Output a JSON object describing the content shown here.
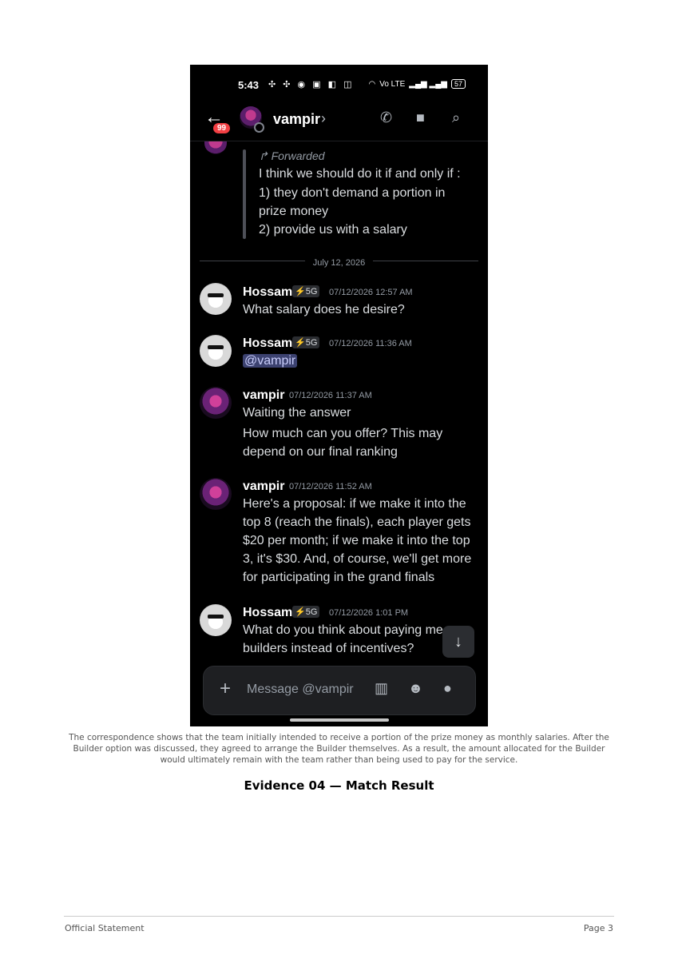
{
  "status_bar": {
    "time": "5:43",
    "notification_icons": "✣ ✣ ◉ ▣ ◧ ◫",
    "network": "Vo LTE",
    "signal": "▂▄▆ ▂▄▆",
    "battery": "57"
  },
  "header": {
    "unread_badge": "99",
    "name": "vampir",
    "chevron": "›"
  },
  "forwarded": {
    "label": "Forwarded",
    "lines": [
      "I think we should do it if and only if :",
      "1) they don't demand a portion in",
      "prize money",
      "2) provide us with a salary"
    ]
  },
  "date_divider": "July 12, 2026",
  "messages": [
    {
      "author": "Hossam",
      "tag": "5G",
      "timestamp": "07/12/2026 12:57 AM",
      "text": "What salary does he desire?"
    },
    {
      "author": "Hossam",
      "tag": "5G",
      "timestamp": "07/12/2026 11:36 AM",
      "mention": "@vampir"
    },
    {
      "author": "vampir",
      "timestamp": "07/12/2026 11:37 AM",
      "lines": [
        "Waiting the answer",
        "How much can you offer? This may",
        "depend on our final ranking"
      ]
    },
    {
      "author": "vampir",
      "timestamp": "07/12/2026 11:52 AM",
      "lines": [
        "Here's a proposal: if we make it into the",
        "top 8 (reach the finals), each player gets",
        "$20 per month; if we make it into the top",
        "3, it's $30. And, of course, we'll get more",
        "for participating in the grand finals"
      ]
    },
    {
      "author": "Hossam",
      "tag": "5G",
      "timestamp": "07/12/2026 1:01 PM",
      "lines": [
        "What do you think about paying me",
        "builders instead of incentives?"
      ]
    }
  ],
  "composer": {
    "placeholder": "Message @vampir"
  },
  "icons": {
    "back": "back-arrow-icon",
    "call": "phone-icon",
    "video": "video-icon",
    "search": "search-icon",
    "forward": "forward-arrow-icon",
    "jump": "arrow-down-icon",
    "plus": "plus-icon",
    "gift": "gift-icon",
    "emoji": "emoji-icon",
    "mic": "microphone-icon"
  },
  "colors": {
    "background": "#000000",
    "mention_bg": "#3c4270",
    "badge": "#f23f43",
    "muted": "#949ba4"
  },
  "caption": "The correspondence shows that the team initially intended to receive a portion of the prize money as monthly salaries. After the Builder option was discussed, they agreed to arrange the Builder themselves. As a result, the amount allocated for the Builder would ultimately remain with the team rather than being used to pay for the service.",
  "evidence_title": "Evidence 04 — Match Result",
  "footer": {
    "left": "Official Statement",
    "right": "Page 3"
  }
}
